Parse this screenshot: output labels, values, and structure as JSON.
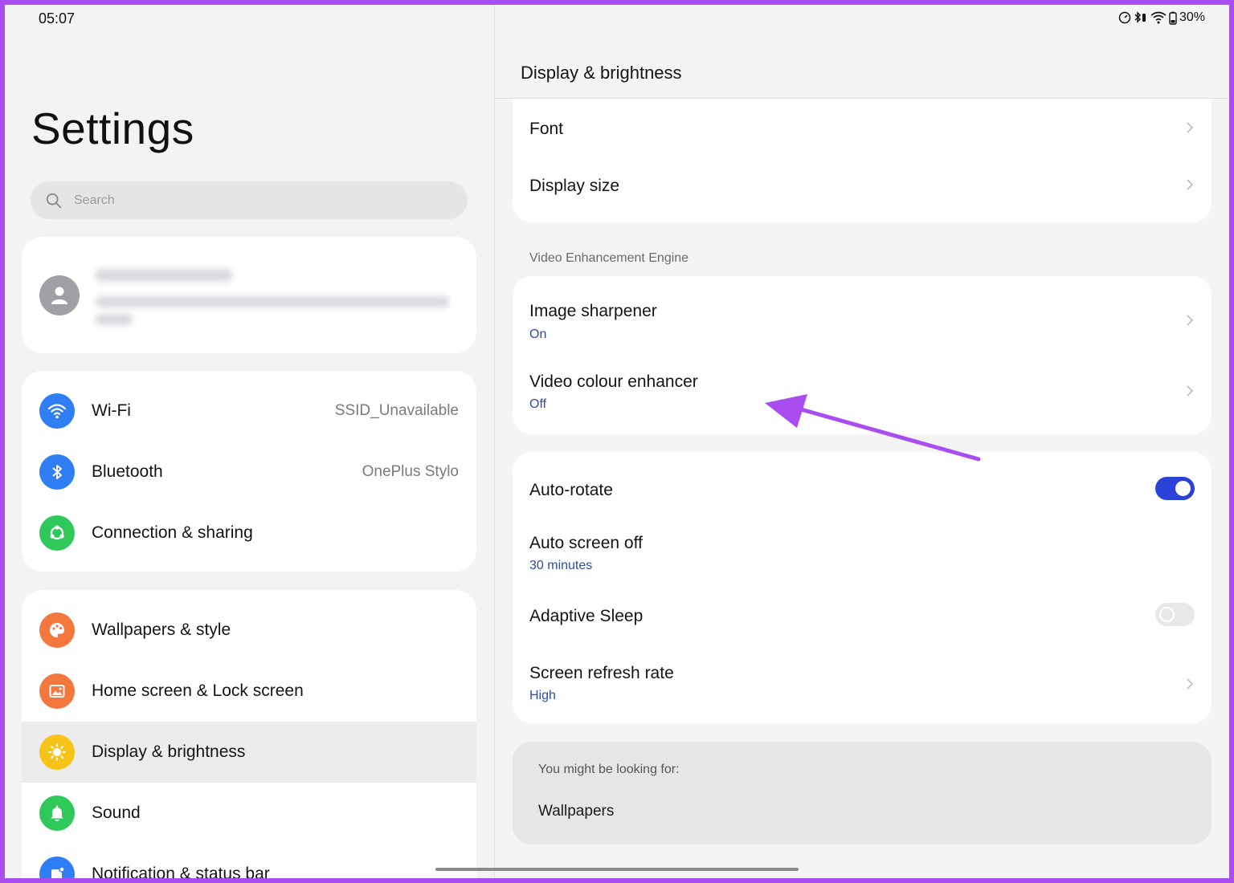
{
  "status_bar": {
    "time": "05:07",
    "battery": "30%",
    "icons": [
      "speedometer-icon",
      "bluetooth-vibrate-icon",
      "wifi-icon",
      "battery-icon"
    ]
  },
  "left": {
    "title": "Settings",
    "search": {
      "placeholder": "Search",
      "icon": "search-icon"
    },
    "account": {
      "avatar_icon": "person-icon"
    },
    "groups": [
      {
        "items": [
          {
            "label": "Wi-Fi",
            "value": "SSID_Unavailable",
            "icon": "wifi-icon",
            "color": "#2f7ef6"
          },
          {
            "label": "Bluetooth",
            "value": "OnePlus Stylo",
            "icon": "bluetooth-icon",
            "color": "#2f7ef6"
          },
          {
            "label": "Connection & sharing",
            "value": "",
            "icon": "share-icon",
            "color": "#2ec95a"
          }
        ]
      },
      {
        "items": [
          {
            "label": "Wallpapers & style",
            "icon": "palette-icon",
            "color": "#f4773d"
          },
          {
            "label": "Home screen & Lock screen",
            "icon": "image-icon",
            "color": "#f4773d"
          },
          {
            "label": "Display & brightness",
            "icon": "sun-icon",
            "color": "#f7c316",
            "selected": true
          },
          {
            "label": "Sound",
            "icon": "bell-icon",
            "color": "#2ec95a"
          },
          {
            "label": "Notification & status bar",
            "icon": "notification-icon",
            "color": "#2f7ef6"
          }
        ]
      }
    ]
  },
  "right": {
    "title": "Display & brightness",
    "card1": [
      {
        "title": "Font"
      },
      {
        "title": "Display size"
      }
    ],
    "section_label": "Video Enhancement Engine",
    "card2": [
      {
        "title": "Image sharpener",
        "sub": "On"
      },
      {
        "title": "Video colour enhancer",
        "sub": "Off"
      }
    ],
    "card3": [
      {
        "title": "Auto-rotate",
        "toggle": "on"
      },
      {
        "title": "Auto screen off",
        "sub": "30 minutes"
      },
      {
        "title": "Adaptive Sleep",
        "toggle": "off"
      },
      {
        "title": "Screen refresh rate",
        "sub": "High"
      }
    ],
    "suggest": {
      "label": "You might be looking for:",
      "item": "Wallpapers"
    }
  },
  "colors": {
    "accent": "#2a42d6",
    "subtext": "#2b4da6",
    "annotation": "#a94cf0"
  }
}
